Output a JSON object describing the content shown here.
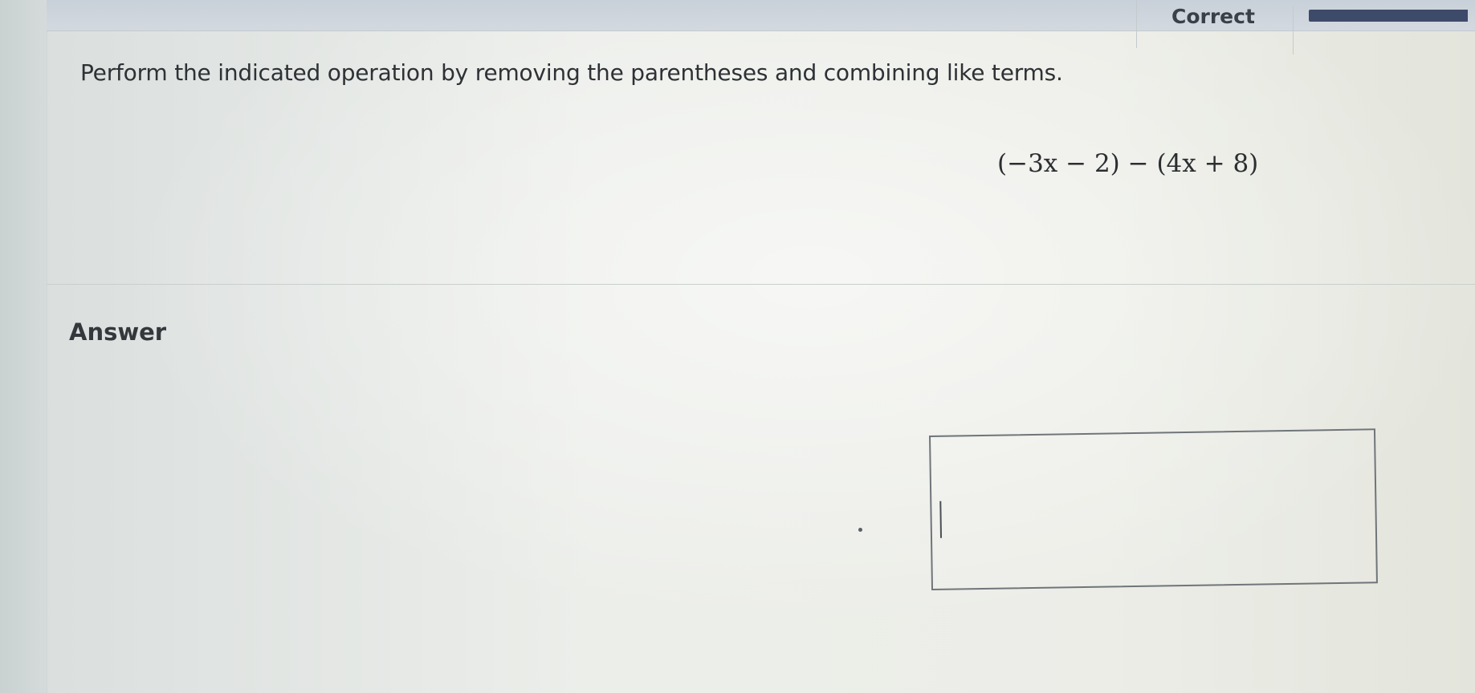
{
  "header": {
    "status_label": "Correct",
    "progress_fraction": 0.95
  },
  "question": {
    "instruction": "Perform the indicated operation by removing the parentheses and combining like terms.",
    "expression": "(−3x − 2) − (4x + 8)"
  },
  "answer": {
    "label": "Answer",
    "input_value": ""
  },
  "colors": {
    "progress_fill": "#3d4a6a",
    "status_text": "#3a4048"
  },
  "icons": {
    "text_cursor": "text-caret-icon"
  }
}
